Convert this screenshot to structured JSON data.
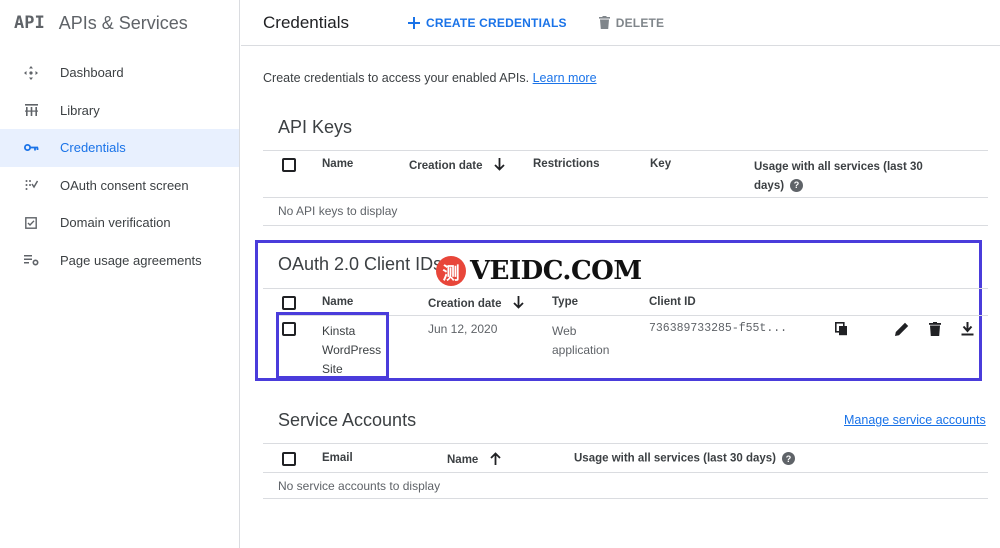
{
  "brand": {
    "logo": "API",
    "title": "APIs & Services"
  },
  "sidebar": {
    "items": [
      {
        "label": "Dashboard",
        "icon": "dashboard-icon"
      },
      {
        "label": "Library",
        "icon": "library-icon"
      },
      {
        "label": "Credentials",
        "icon": "key-icon",
        "active": true
      },
      {
        "label": "OAuth consent screen",
        "icon": "oauth-consent-icon"
      },
      {
        "label": "Domain verification",
        "icon": "domain-verification-icon"
      },
      {
        "label": "Page usage agreements",
        "icon": "page-usage-settings-icon"
      }
    ]
  },
  "header": {
    "title": "Credentials",
    "create_label": "CREATE CREDENTIALS",
    "delete_label": "DELETE"
  },
  "main": {
    "intro_text": "Create credentials to access your enabled APIs.",
    "learn_more": "Learn more",
    "api_keys": {
      "title": "API Keys",
      "columns": [
        "Name",
        "Creation date",
        "Restrictions",
        "Key",
        "Usage with all services (last 30",
        "days)"
      ],
      "empty": "No API keys to display"
    },
    "oauth": {
      "title": "OAuth 2.0 Client IDs",
      "columns": [
        "Name",
        "Creation date",
        "Type",
        "Client ID"
      ],
      "rows": [
        {
          "name_lines": [
            "Kinsta",
            "WordPress",
            "Site"
          ],
          "date": "Jun 12, 2020",
          "type_lines": [
            "Web",
            "application"
          ],
          "client_id": "736389733285-f55t..."
        }
      ]
    },
    "service_accounts": {
      "title": "Service Accounts",
      "manage": "Manage service accounts",
      "columns": [
        "Email",
        "Name",
        "Usage with all services (last 30 days)"
      ],
      "empty": "No service accounts to display"
    }
  },
  "watermark": {
    "seal": "测",
    "text": "VEIDC.COM"
  },
  "colors": {
    "accent": "#1a73e8",
    "highlight": "#4a3cdb",
    "active_bg": "#e8f0fe"
  }
}
